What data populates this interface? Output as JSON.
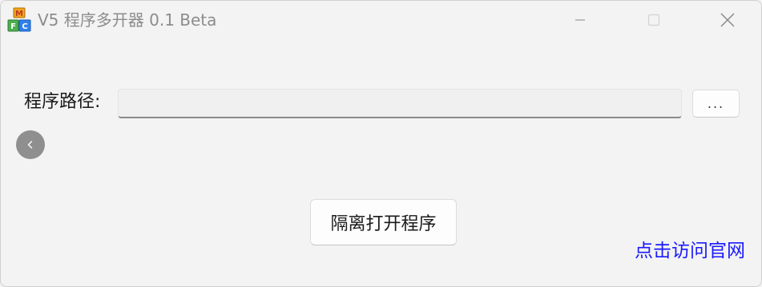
{
  "window": {
    "title": "V5 程序多开器 0.1 Beta",
    "app_icon": "multi-window-app-icon"
  },
  "titlebar_controls": {
    "minimize_icon": "minimize-icon",
    "maximize_icon": "maximize-icon",
    "close_icon": "close-icon"
  },
  "form": {
    "path_label": "程序路径:",
    "path_value": "",
    "path_placeholder": "",
    "browse_label": "...",
    "back_icon": "chevron-left-icon",
    "open_button_label": "隔离打开程序"
  },
  "footer": {
    "site_link_label": "点击访问官网"
  },
  "colors": {
    "window_bg": "#f3f3f3",
    "title_text": "#8c8c8c",
    "link": "#1a1aff",
    "back_button": "#8f8f8f"
  }
}
